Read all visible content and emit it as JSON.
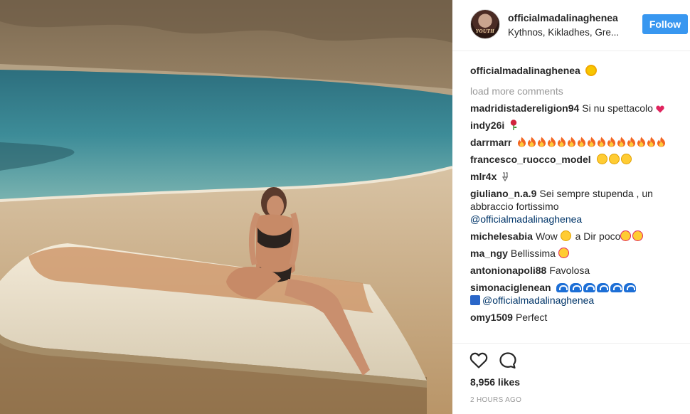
{
  "post": {
    "username": "officialmadalinaghenea",
    "location": "Kythnos, Kikladhes, Gre...",
    "follow_label": "Follow",
    "avatar_text": "YOUTH",
    "caption_username": "officialmadalinaghenea",
    "caption_icon": "sun-emoji",
    "load_more": "load more comments"
  },
  "comments": [
    {
      "username": "madridistadereligion94",
      "text": "Si nu spettacolo",
      "emojis": [
        "heart"
      ]
    },
    {
      "username": "indy26i",
      "text": "",
      "emojis": [
        "rose"
      ]
    },
    {
      "username": "darrmarr",
      "text": "",
      "emojis": [
        "fire",
        "fire",
        "fire",
        "fire",
        "fire",
        "fire",
        "fire",
        "fire",
        "fire",
        "fire",
        "fire",
        "fire",
        "fire",
        "fire",
        "fire"
      ]
    },
    {
      "username": "francesco_ruocco_model",
      "text": "",
      "emojis": [
        "face",
        "face",
        "face"
      ]
    },
    {
      "username": "mlr4x",
      "text": "",
      "emojis": [
        "pin"
      ]
    },
    {
      "username": "giuliano_n.a.9",
      "text": "Sei sempre stupenda , un abbraccio fortissimo",
      "mention": "@officialmadalinaghenea"
    },
    {
      "username": "michelesabia",
      "text": "Wow",
      "emojis": [
        "face"
      ],
      "text2": "a Dir poco",
      "emojis2": [
        "face",
        "face"
      ]
    },
    {
      "username": "ma_ngy",
      "text": "Bellissima",
      "emojis": [
        "face"
      ]
    },
    {
      "username": "antonionapoli88",
      "text": "Favolosa"
    },
    {
      "username": "simonaciglenean",
      "text": "",
      "emojis": [
        "wave",
        "wave",
        "wave",
        "wave",
        "wave",
        "wave"
      ],
      "emojis_line2": [
        "flag"
      ],
      "mention": "@officialmadalinaghenea"
    },
    {
      "username": "omy1509",
      "text": "Perfect"
    }
  ],
  "actions": {
    "like_icon": "heart-outline-icon",
    "comment_icon": "speech-bubble-icon",
    "likes": "8,956 likes",
    "time": "2 HOURS AGO"
  },
  "colors": {
    "follow_bg": "#3897f0",
    "mention": "#003569",
    "muted": "#999999"
  }
}
